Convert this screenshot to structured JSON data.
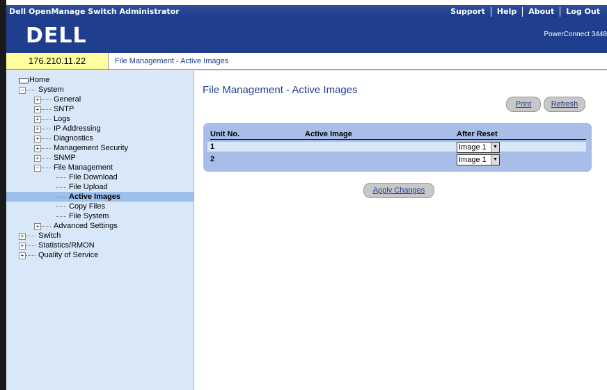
{
  "app": {
    "title": "Dell OpenManage Switch Administrator",
    "links": [
      "Support",
      "Help",
      "About",
      "Log Out"
    ],
    "logo": "DELL",
    "model": "PowerConnect 3448"
  },
  "breadcrumb": {
    "ip": "176.210.11.22",
    "path": "File Management - Active Images"
  },
  "tree": [
    {
      "label": "Home",
      "level": 0,
      "icon": "drive-icon"
    },
    {
      "label": "System",
      "level": 1,
      "expander": "−"
    },
    {
      "label": "General",
      "level": 2,
      "expander": "+"
    },
    {
      "label": "SNTP",
      "level": 2,
      "expander": "+"
    },
    {
      "label": "Logs",
      "level": 2,
      "expander": "+"
    },
    {
      "label": "IP Addressing",
      "level": 2,
      "expander": "+"
    },
    {
      "label": "Diagnostics",
      "level": 2,
      "expander": "+"
    },
    {
      "label": "Management Security",
      "level": 2,
      "expander": "+"
    },
    {
      "label": "SNMP",
      "level": 2,
      "expander": "+"
    },
    {
      "label": "File Management",
      "level": 2,
      "expander": "−"
    },
    {
      "label": "File Download",
      "level": 3
    },
    {
      "label": "File Upload",
      "level": 3
    },
    {
      "label": "Active Images",
      "level": 3,
      "selected": true
    },
    {
      "label": "Copy Files",
      "level": 3
    },
    {
      "label": "File System",
      "level": 3
    },
    {
      "label": "Advanced Settings",
      "level": 2,
      "expander": "+"
    },
    {
      "label": "Switch",
      "level": 1,
      "expander": "+"
    },
    {
      "label": "Statistics/RMON",
      "level": 1,
      "expander": "+"
    },
    {
      "label": "Quality of Service",
      "level": 1,
      "expander": "+"
    }
  ],
  "main": {
    "title": "File Management - Active Images",
    "print_label": "Print",
    "refresh_label": "Refresh",
    "apply_label": "Apply Changes",
    "columns": [
      "Unit No.",
      "Active Image",
      "After Reset"
    ],
    "rows": [
      {
        "unit": "1",
        "active_image": "",
        "after_reset": "Image 1"
      },
      {
        "unit": "2",
        "active_image": "",
        "after_reset": "Image 1"
      }
    ]
  },
  "colors": {
    "header_blue": "#1f3f8e",
    "sidebar_bg": "#d8e8f8",
    "panel_bg": "#a8bee8",
    "ip_bg": "#ffffa0"
  }
}
